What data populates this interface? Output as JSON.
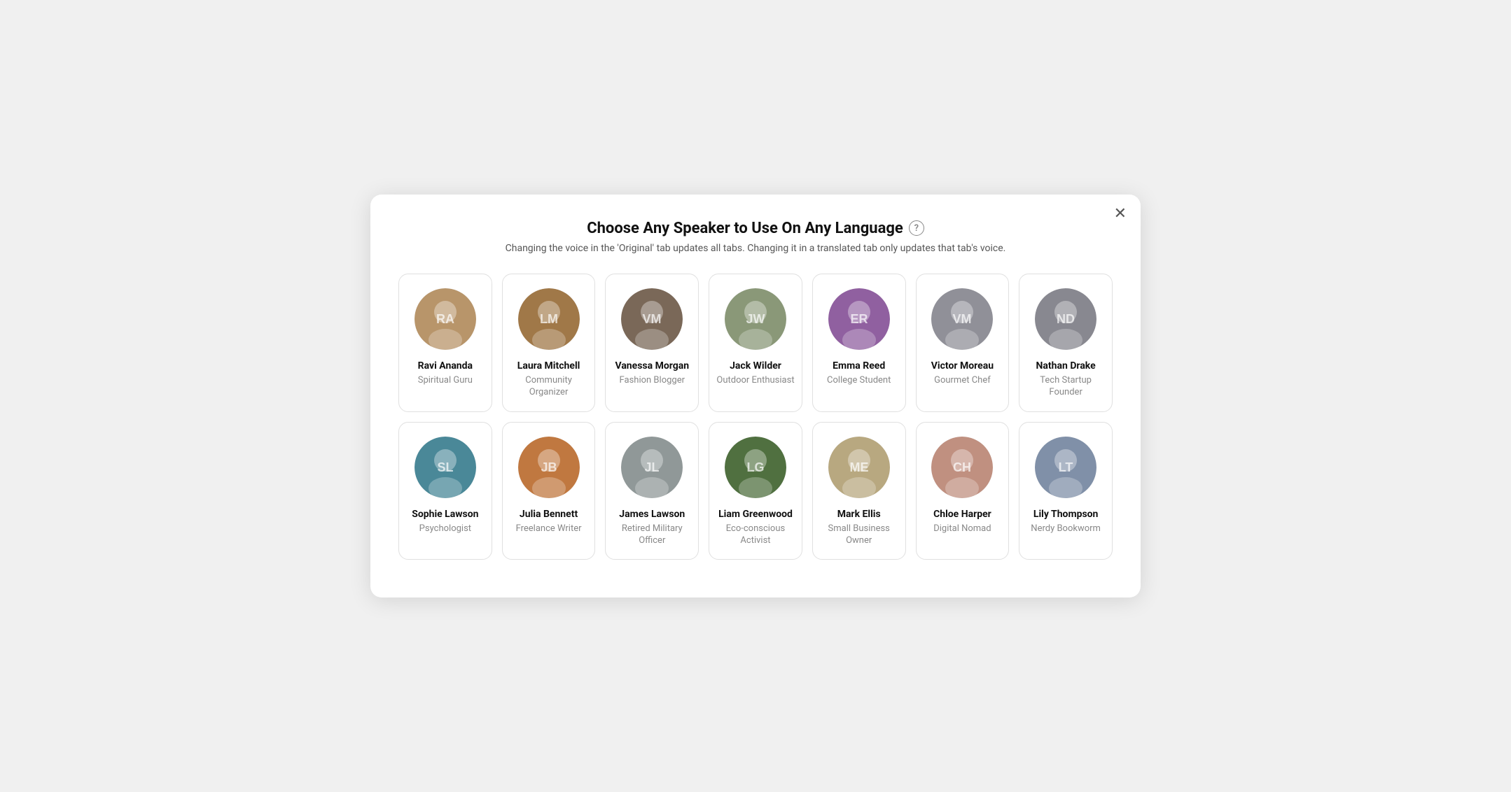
{
  "modal": {
    "title": "Choose Any Speaker to Use On Any Language",
    "subtitle": "Changing the voice in the 'Original' tab updates all tabs. Changing it in a translated tab only updates that tab's voice.",
    "close_label": "✕",
    "help_icon_label": "?"
  },
  "speakers_row1": [
    {
      "name": "Ravi Ananda",
      "role": "Spiritual Guru",
      "av_class": "av-warm",
      "initials": "RA",
      "color": "#b8956a"
    },
    {
      "name": "Laura Mitchell",
      "role": "Community Organizer",
      "av_class": "av-warm",
      "initials": "LM",
      "color": "#a07848"
    },
    {
      "name": "Vanessa Morgan",
      "role": "Fashion Blogger",
      "av_class": "av-gray",
      "initials": "VM",
      "color": "#7a6858"
    },
    {
      "name": "Jack Wilder",
      "role": "Outdoor Enthusiast",
      "av_class": "av-gray",
      "initials": "JW",
      "color": "#8a9878"
    },
    {
      "name": "Emma Reed",
      "role": "College Student",
      "av_class": "av-purple",
      "initials": "ER",
      "color": "#9060a0"
    },
    {
      "name": "Victor Moreau",
      "role": "Gourmet Chef",
      "av_class": "av-gray",
      "initials": "VM",
      "color": "#909098"
    },
    {
      "name": "Nathan Drake",
      "role": "Tech Startup Founder",
      "av_class": "av-gray",
      "initials": "ND",
      "color": "#888890"
    }
  ],
  "speakers_row2": [
    {
      "name": "Sophie Lawson",
      "role": "Psychologist",
      "av_class": "av-teal",
      "initials": "SL",
      "color": "#4a8898"
    },
    {
      "name": "Julia Bennett",
      "role": "Freelance Writer",
      "av_class": "av-orange",
      "initials": "JB",
      "color": "#c07840"
    },
    {
      "name": "James Lawson",
      "role": "Retired Military Officer",
      "av_class": "av-gray",
      "initials": "JL",
      "color": "#909898"
    },
    {
      "name": "Liam Greenwood",
      "role": "Eco-conscious Activist",
      "av_class": "av-green",
      "initials": "LG",
      "color": "#507040"
    },
    {
      "name": "Mark Ellis",
      "role": "Small Business Owner",
      "av_class": "av-tan",
      "initials": "ME",
      "color": "#b8a880"
    },
    {
      "name": "Chloe Harper",
      "role": "Digital Nomad",
      "av_class": "av-rose",
      "initials": "CH",
      "color": "#c09080"
    },
    {
      "name": "Lily Thompson",
      "role": "Nerdy Bookworm",
      "av_class": "av-cool",
      "initials": "LT",
      "color": "#8090a8"
    }
  ]
}
